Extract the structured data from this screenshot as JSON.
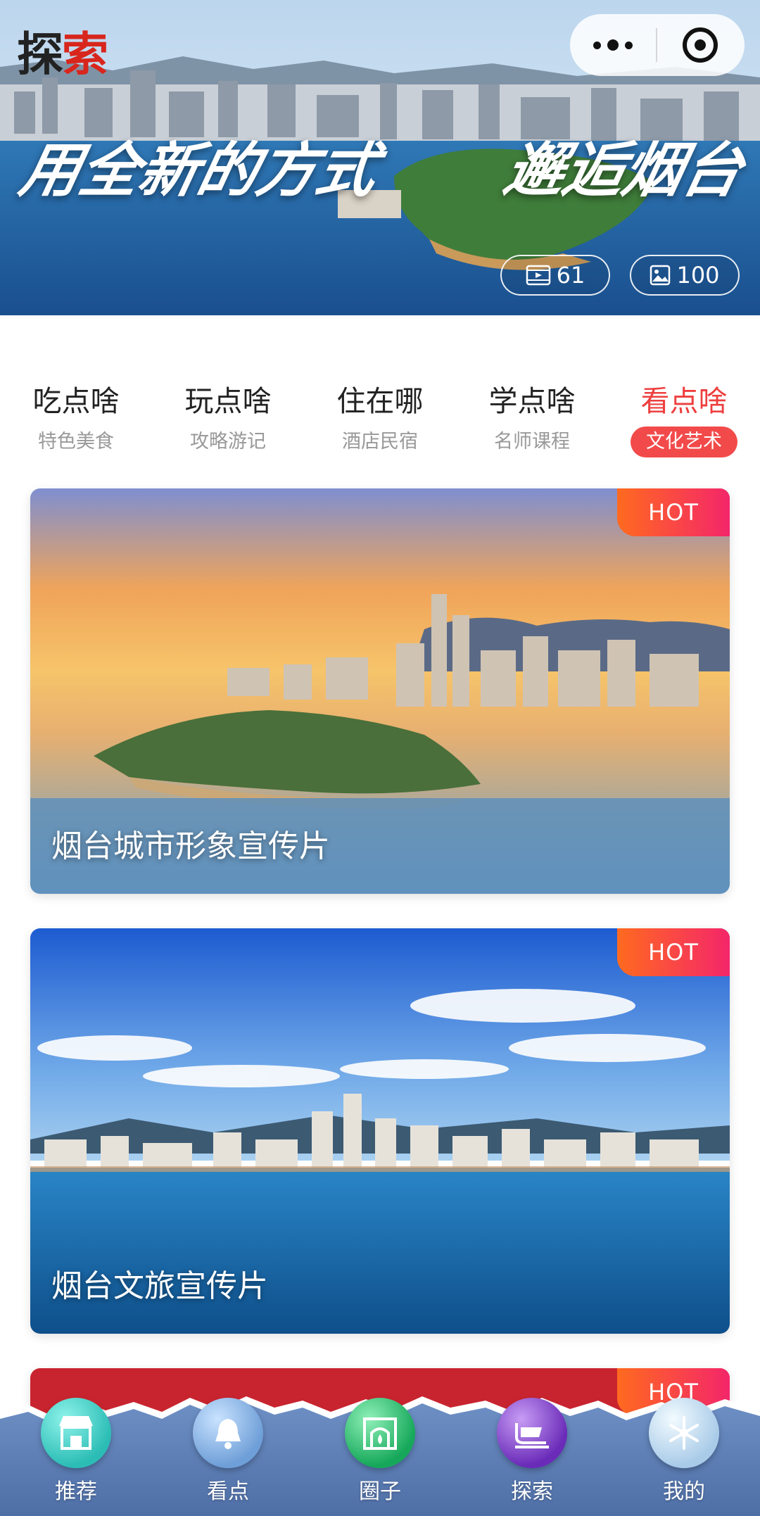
{
  "hero": {
    "logo_part1": "探",
    "logo_part2": "索",
    "slogan_part1": "用全新的方式",
    "slogan_part2": "邂逅烟台",
    "video_count": "61",
    "photo_count": "100",
    "video_icon": "film-icon",
    "photo_icon": "image-icon"
  },
  "capsule": {
    "more_icon": "more-dots-icon",
    "close_icon": "target-icon"
  },
  "categories": [
    {
      "title": "吃点啥",
      "subtitle": "特色美食"
    },
    {
      "title": "玩点啥",
      "subtitle": "攻略游记"
    },
    {
      "title": "住在哪",
      "subtitle": "酒店民宿"
    },
    {
      "title": "学点啥",
      "subtitle": "名师课程"
    },
    {
      "title": "看点啥",
      "subtitle": "文化艺术"
    }
  ],
  "active_category": "看点啥",
  "cards": [
    {
      "title": "烟台城市形象宣传片",
      "badge": "HOT"
    },
    {
      "title": "烟台文旅宣传片",
      "badge": "HOT"
    },
    {
      "title": "",
      "badge": "HOT"
    }
  ],
  "tabbar": [
    {
      "label": "推荐",
      "icon": "shop-icon"
    },
    {
      "label": "看点",
      "icon": "bell-icon"
    },
    {
      "label": "圈子",
      "icon": "fireplace-icon"
    },
    {
      "label": "探索",
      "icon": "sleigh-icon"
    },
    {
      "label": "我的",
      "icon": "snowflake-icon"
    }
  ],
  "colors": {
    "accent": "#f24a4a",
    "hot_gradient_start": "#ff6a1f",
    "hot_gradient_end": "#f4266a",
    "tabbar_bg": "#5a7ab0"
  }
}
